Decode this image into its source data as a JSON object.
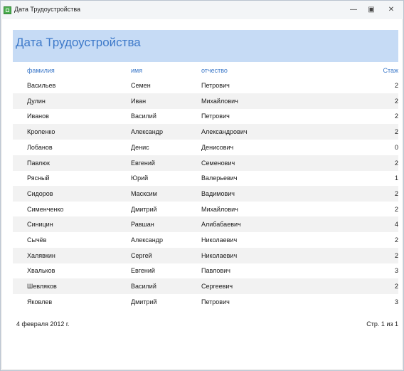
{
  "window": {
    "title": "Дата Трудоустройства",
    "minimize_glyph": "—",
    "restore_glyph": "▣",
    "close_glyph": "✕"
  },
  "report": {
    "title": "Дата Трудоустройства",
    "columns": [
      "фамилия",
      "имя",
      "отчество",
      "Стаж"
    ],
    "rows": [
      [
        "Васильев",
        "Семен",
        "Петрович",
        "2"
      ],
      [
        "Дулин",
        "Иван",
        "Михайлович",
        "2"
      ],
      [
        "Иванов",
        "Василий",
        "Петрович",
        "2"
      ],
      [
        "Кроленко",
        "Александр",
        "Александрович",
        "2"
      ],
      [
        "Лобанов",
        "Денис",
        "Денисович",
        "0"
      ],
      [
        "Павлюк",
        "Евгений",
        "Семенович",
        "2"
      ],
      [
        "Рясный",
        "Юрий",
        "Валерьевич",
        "1"
      ],
      [
        "Сидоров",
        "Масксим",
        "Вадимович",
        "2"
      ],
      [
        "Сименченко",
        "Дмитрий",
        "Михайлович",
        "2"
      ],
      [
        "Синицин",
        "Равшан",
        "Алибабаевич",
        "4"
      ],
      [
        "Сычёв",
        "Александр",
        "Николаевич",
        "2"
      ],
      [
        "Халявкин",
        "Сергей",
        "Николаевич",
        "2"
      ],
      [
        "Хвальков",
        "Евгений",
        "Павлович",
        "3"
      ],
      [
        "Шевляков",
        "Василий",
        "Сергеевич",
        "2"
      ],
      [
        "Яковлев",
        "Дмитрий",
        "Петрович",
        "3"
      ]
    ],
    "footer": {
      "date": "4 февраля 2012 г.",
      "page": "Стр. 1 из 1"
    }
  }
}
